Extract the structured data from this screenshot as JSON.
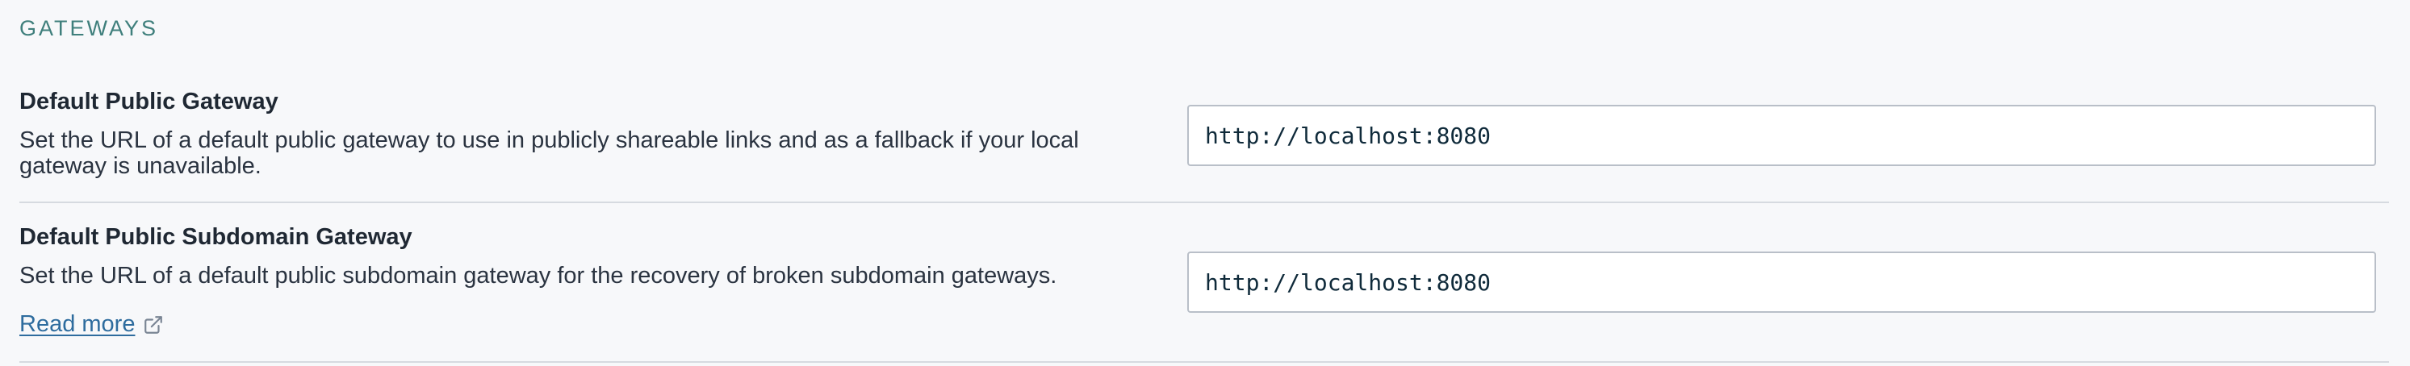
{
  "section": {
    "heading": "GATEWAYS"
  },
  "public_gateway": {
    "title": "Default Public Gateway",
    "description": "Set the URL of a default public gateway to use in publicly shareable links and as a fallback if your local gateway is unavailable.",
    "value": "http://localhost:8080"
  },
  "subdomain_gateway": {
    "title": "Default Public Subdomain Gateway",
    "description": "Set the URL of a default public subdomain gateway for the recovery of broken subdomain gateways.",
    "value": "http://localhost:8080",
    "link_label": "Read more",
    "link_icon": "external-link-icon"
  },
  "colors": {
    "heading": "#3f7f7c",
    "link": "#2e6c9e",
    "background": "#f7f8fa",
    "input_border": "#b9bfc8",
    "divider": "#d6dae0"
  }
}
